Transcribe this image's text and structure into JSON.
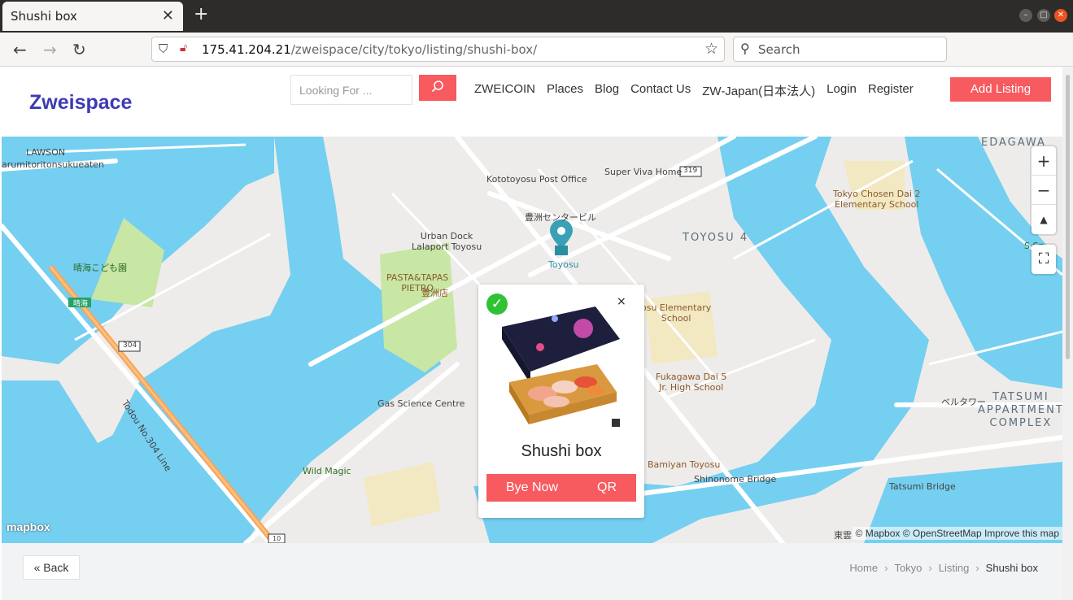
{
  "browser": {
    "tab_title": "Shushi box",
    "url_host": "175.41.204.21",
    "url_path": "/zweispace/city/tokyo/listing/shushi-box/",
    "search_placeholder": "Search"
  },
  "header": {
    "logo": "Zweispace",
    "search_placeholder": "Looking For ...",
    "nav": [
      "ZWEICOIN",
      "Places",
      "Blog",
      "Contact Us",
      "ZW-Japan(日本法人)",
      "Login",
      "Register"
    ],
    "add_listing": "Add Listing"
  },
  "map": {
    "labels": {
      "lawson": "LAWSON",
      "lawson_sub": "arumitoritonsukueaten",
      "post_office": "Kototoyosu Post Office",
      "super_viva": "Super Viva Home",
      "route_319": "319",
      "edagawa": "EDAGAWA",
      "chosen_school": "Tokyo Chosen Dai 2\nElementary School",
      "toyosu_center": "豊洲センタービル",
      "urban_dock": "Urban Dock\nLalaport Toyosu",
      "toyosu_station": "Toyosu",
      "toyosu4": "TOYOSU 4",
      "harumi_park": "晴海こども園",
      "pasta": "PASTA&TAPAS\nPIETRO",
      "pasta_jp": "豊洲店",
      "elementary": "osu Elementary\nSchool",
      "harumi_sign": "晴海",
      "route_304": "304",
      "todou_line": "Todou No.304 Line",
      "fukagawa": "Fukagawa Dai 5\nJr. High School",
      "gas_science": "Gas Science Centre",
      "bellatower": "ベルタワー",
      "tatsumi": "TATSUMI\nAPPARTMENT\nCOMPLEX",
      "wild_magic": "Wild Magic",
      "bamiyan": "Bamiyan Toyosu",
      "shinonome": "Shinonome Bridge",
      "tatsumi_bridge": "Tatsumi Bridge",
      "route_10": "10",
      "shinonome_edge": "東雲",
      "right_edge": "S  Sp"
    },
    "zoom_in": "+",
    "zoom_out": "−",
    "compass": "▲",
    "mapbox": "mapbox",
    "attribution": "© Mapbox © OpenStreetMap Improve this map",
    "popup": {
      "title": "Shushi box",
      "buy_label": "Bye Now",
      "qr_label": "QR",
      "close": "×"
    }
  },
  "breadcrumb": {
    "back": "Back",
    "items": [
      "Home",
      "Tokyo",
      "Listing"
    ],
    "current": "Shushi box"
  },
  "colors": {
    "accent": "#f75a5f",
    "logo": "#3d3bb3",
    "water": "#75cff0",
    "park": "#c8e6a4"
  }
}
